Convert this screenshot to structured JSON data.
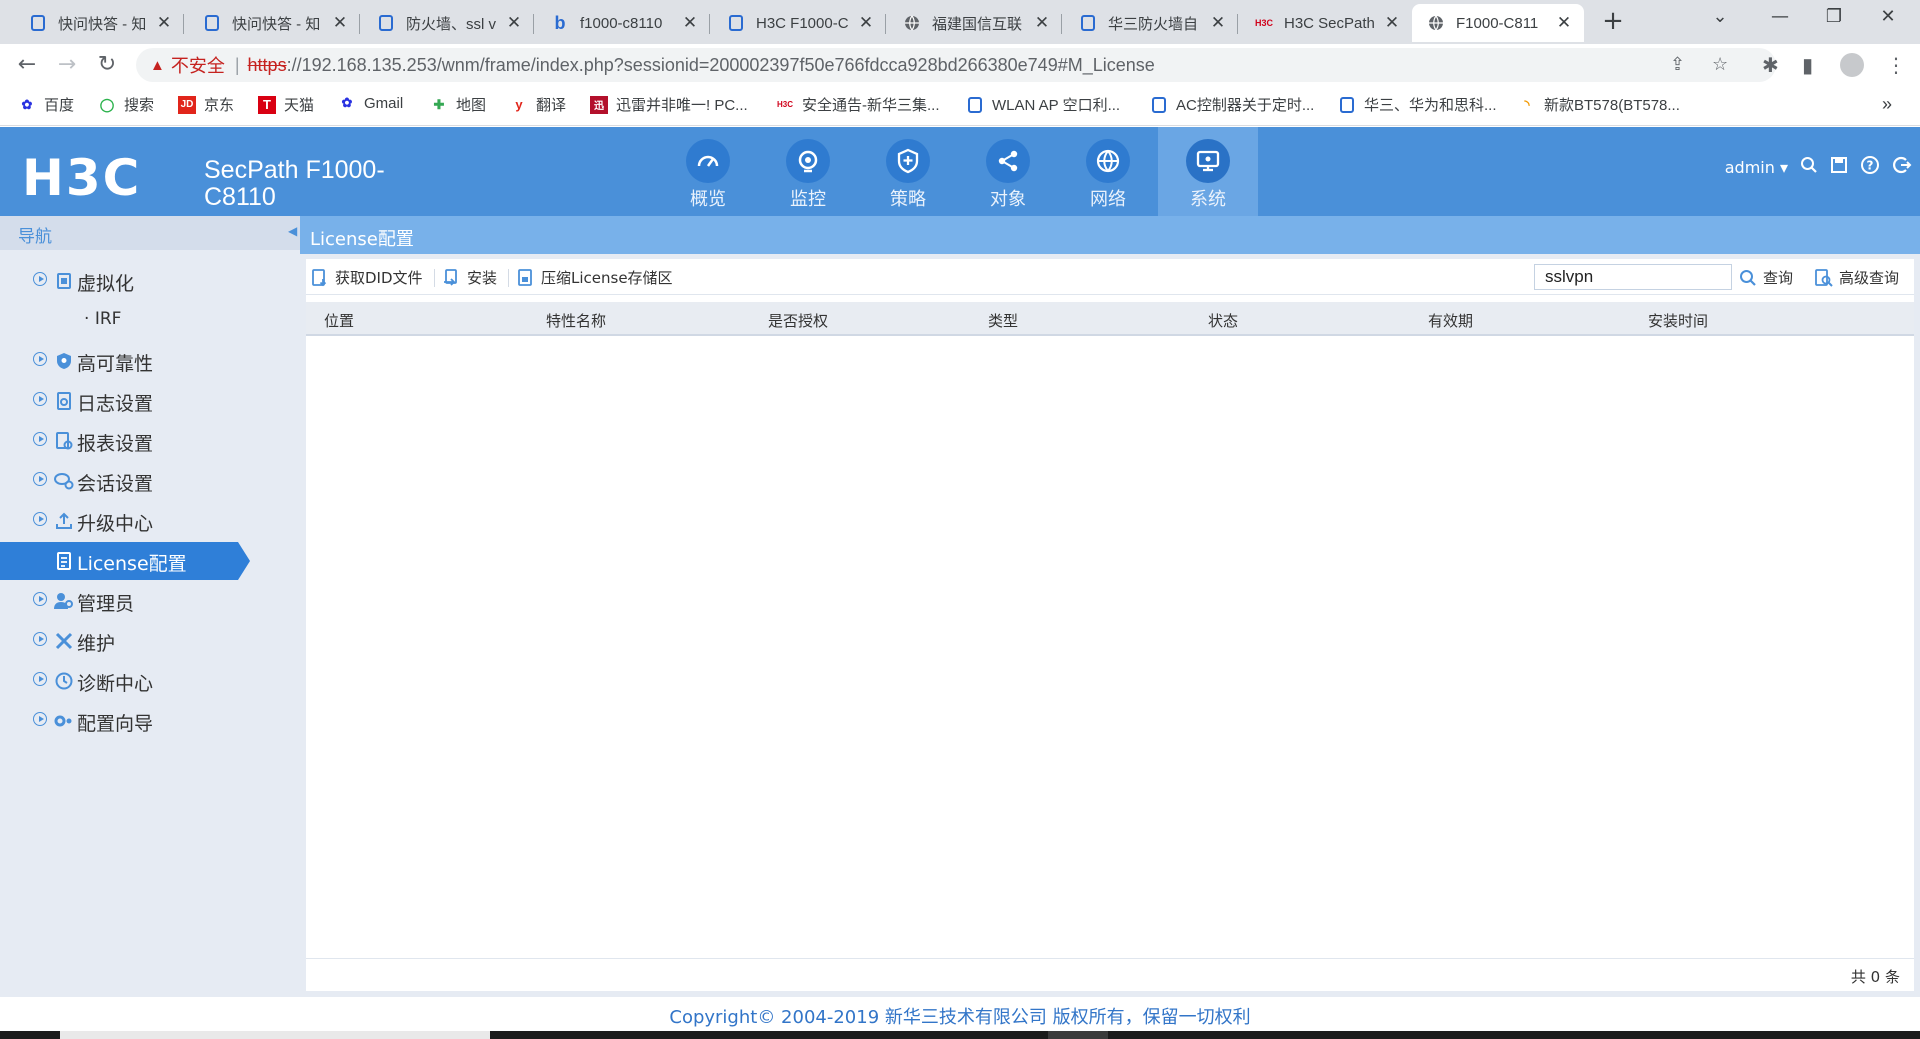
{
  "browser": {
    "tabs": [
      {
        "title": "快问快答 - 知",
        "active": false
      },
      {
        "title": "快问快答 - 知",
        "active": false
      },
      {
        "title": "防火墙、ssl v",
        "active": false
      },
      {
        "title": "f1000-c8110",
        "active": false
      },
      {
        "title": "H3C F1000-C",
        "active": false
      },
      {
        "title": "福建国信互联",
        "active": false
      },
      {
        "title": "华三防火墙自",
        "active": false
      },
      {
        "title": "H3C SecPath",
        "active": false
      },
      {
        "title": "F1000-C811",
        "active": true
      }
    ],
    "new_tab": "+",
    "security_label": "不安全",
    "url_scheme": "https",
    "url_rest": "://192.168.135.253/wnm/frame/index.php?sessionid=200002397f50e766fdcca928bd266380e749#M_License",
    "bookmarks": [
      "百度",
      "搜索",
      "京东",
      "天猫",
      "Gmail",
      "地图",
      "翻译",
      "迅雷并非唯一! PC...",
      "安全通告-新华三集...",
      "WLAN AP 空口利...",
      "AC控制器关于定时...",
      "华三、华为和思科...",
      "新款BT578(BT578..."
    ],
    "bookmarks_more": "»"
  },
  "header": {
    "logo": "H3C",
    "product_line1": "SecPath F1000-",
    "product_line2": "C8110",
    "modules": [
      {
        "label": "概览",
        "icon": "gauge-icon"
      },
      {
        "label": "监控",
        "icon": "camera-icon"
      },
      {
        "label": "策略",
        "icon": "shield-icon"
      },
      {
        "label": "对象",
        "icon": "share-icon"
      },
      {
        "label": "网络",
        "icon": "globe-icon"
      },
      {
        "label": "系统",
        "icon": "monitor-icon",
        "active": true
      }
    ],
    "user": "admin"
  },
  "sidebar": {
    "title": "导航",
    "items": [
      {
        "label": "虚拟化",
        "icon": "virtualization-icon",
        "expandable": true
      },
      {
        "label": "IRF",
        "sub": true
      },
      {
        "label": "高可靠性",
        "icon": "shield-icon",
        "expandable": true
      },
      {
        "label": "日志设置",
        "icon": "log-icon",
        "expandable": true
      },
      {
        "label": "报表设置",
        "icon": "report-icon",
        "expandable": true
      },
      {
        "label": "会话设置",
        "icon": "session-icon",
        "expandable": true
      },
      {
        "label": "升级中心",
        "icon": "upload-icon",
        "expandable": true
      },
      {
        "label": "License配置",
        "icon": "license-icon",
        "active": true
      },
      {
        "label": "管理员",
        "icon": "admin-icon",
        "expandable": true
      },
      {
        "label": "维护",
        "icon": "tools-icon",
        "expandable": true
      },
      {
        "label": "诊断中心",
        "icon": "diagnose-icon",
        "expandable": true
      },
      {
        "label": "配置向导",
        "icon": "wizard-icon",
        "expandable": true
      }
    ]
  },
  "content": {
    "title": "License配置",
    "actions": {
      "get_did": "获取DID文件",
      "install": "安装",
      "compress": "压缩License存储区"
    },
    "search": {
      "value": "sslvpn",
      "query_label": "查询",
      "advanced_label": "高级查询"
    },
    "columns": [
      "位置",
      "特性名称",
      "是否授权",
      "类型",
      "状态",
      "有效期",
      "安装时间"
    ],
    "rows": [],
    "total": "共 0 条"
  },
  "footer": {
    "copyright": "Copyright© 2004-2019 新华三技术有限公司 版权所有，保留一切权利"
  },
  "colors": {
    "header": "#4a90d9",
    "accent": "#2f7fd8",
    "sidebar_bg": "#e6ebf3",
    "insecure": "#c5221f"
  }
}
